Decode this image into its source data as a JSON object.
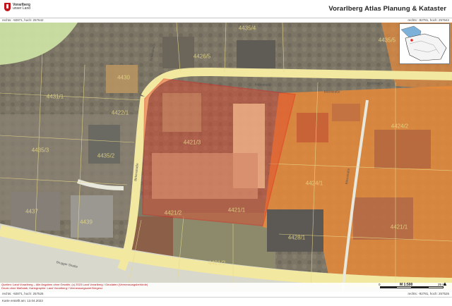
{
  "header": {
    "logo_label": "Vorarlberg",
    "logo_sublabel": "unser Land",
    "title": "Vorarlberg Atlas Planung & Kataster"
  },
  "coordinates": {
    "top_left": "rechts: -92871, hoch: 257642",
    "top_right": "rechts: -92781, hoch: 257642",
    "bottom_left": "rechts: -92871, hoch: 257526",
    "bottom_right": "rechts: -92781, hoch: 257526"
  },
  "map": {
    "parcel_labels": [
      {
        "text": "4435/4"
      },
      {
        "text": "4435/5"
      },
      {
        "text": "4426/5"
      },
      {
        "text": "4430"
      },
      {
        "text": "4431/1"
      },
      {
        "text": "4424/2"
      },
      {
        "text": "4435/3"
      },
      {
        "text": "4435/2"
      },
      {
        "text": "4421/3"
      },
      {
        "text": "4422/1"
      },
      {
        "text": "4424/1"
      },
      {
        "text": "4421/1"
      },
      {
        "text": "4421/2"
      },
      {
        "text": "4421/2"
      },
      {
        "text": "4437"
      },
      {
        "text": "4439"
      },
      {
        "text": "4421/1"
      },
      {
        "text": "4428/1"
      }
    ],
    "streets": [
      {
        "text": "Birkenstraße"
      },
      {
        "text": "Bitzestraße"
      },
      {
        "text": "Bitzestraße"
      },
      {
        "text": "Bitzestraße"
      },
      {
        "text": "Birkenstraße"
      },
      {
        "text": "Brugger Straße"
      },
      {
        "text": "Bitzestraße"
      }
    ],
    "colors": {
      "selected_parcel": "#e4462c",
      "overlay_orange": "#e88a3a",
      "road": "#f2e8a0",
      "green_zone": "#cfe6a6",
      "parcel_lines": "#e7d889"
    }
  },
  "scale": {
    "zero": "0",
    "ratio": "M 1:500",
    "unit": "25 m"
  },
  "disclaimer": {
    "line1": "Quellen: Land Vorarlberg – Alle Angaben ohne Gewähr, (c) 2023 Land Vorarlberg / Geodaten (Vermessungsbehörde)",
    "line2": "Druck ohne Maßstab, Kartographie: Land Vorarlberg / Vermessungsamt Bregenz"
  },
  "footer": {
    "date": "Karte erstellt am: 13.04.2023"
  }
}
